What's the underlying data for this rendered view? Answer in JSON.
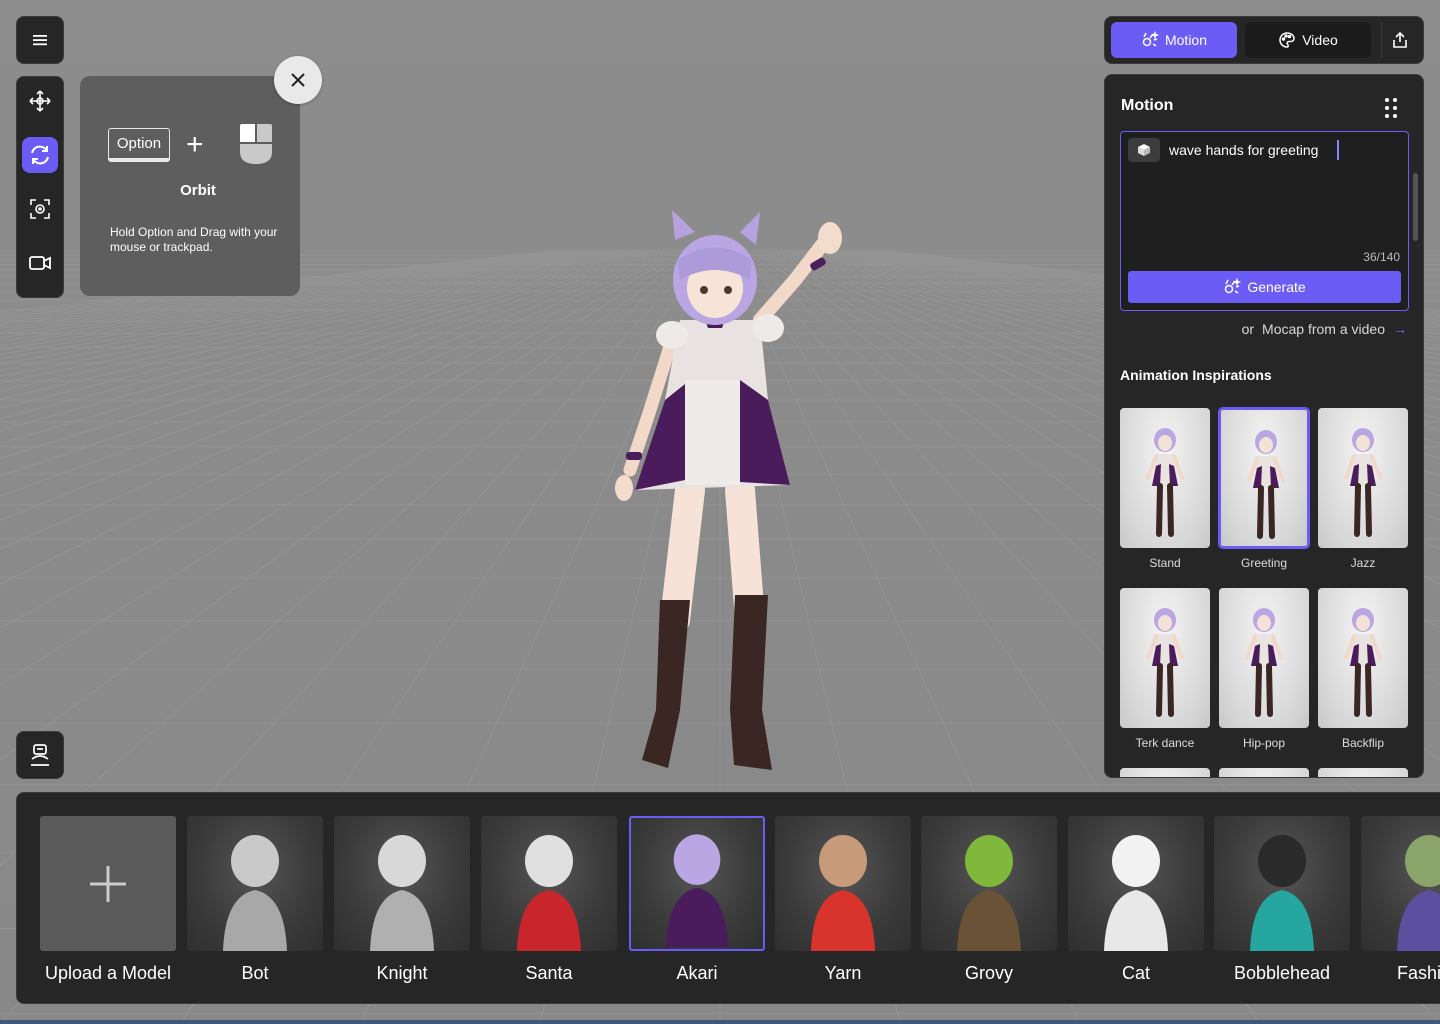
{
  "toolbar": {
    "menu_icon": "hamburger-icon",
    "tools": [
      {
        "name": "move",
        "icon": "move-arrows-icon",
        "active": false
      },
      {
        "name": "orbit",
        "icon": "orbit-rotate-icon",
        "active": true
      },
      {
        "name": "focus",
        "icon": "focus-target-icon",
        "active": false
      },
      {
        "name": "camera",
        "icon": "video-camera-icon",
        "active": false
      }
    ]
  },
  "orbit_tip": {
    "key": "Option",
    "plus": "+",
    "title": "Orbit",
    "description": "Hold Option and Drag with your mouse or trackpad."
  },
  "top_tabs": {
    "motion": "Motion",
    "video": "Video"
  },
  "motion_panel": {
    "title": "Motion",
    "prompt": "wave hands for greeting",
    "char_count": "36/140",
    "generate": "Generate",
    "mocap_prefix": "or",
    "mocap_link": "Mocap from a video",
    "mocap_arrow": "→",
    "inspirations_title": "Animation Inspirations",
    "inspirations": [
      "Stand",
      "Greeting",
      "Jazz",
      "Terk dance",
      "Hip-pop",
      "Backflip"
    ],
    "selected_inspiration": "Greeting"
  },
  "models": {
    "upload_label": "Upload a Model",
    "items": [
      "Bot",
      "Knight",
      "Santa",
      "Akari",
      "Yarn",
      "Grovy",
      "Cat",
      "Bobblehead",
      "Fashion"
    ],
    "selected": "Akari"
  },
  "colors": {
    "accent": "#6c5cf6",
    "panel": "#262626",
    "viewport": "#8a8a8a"
  }
}
